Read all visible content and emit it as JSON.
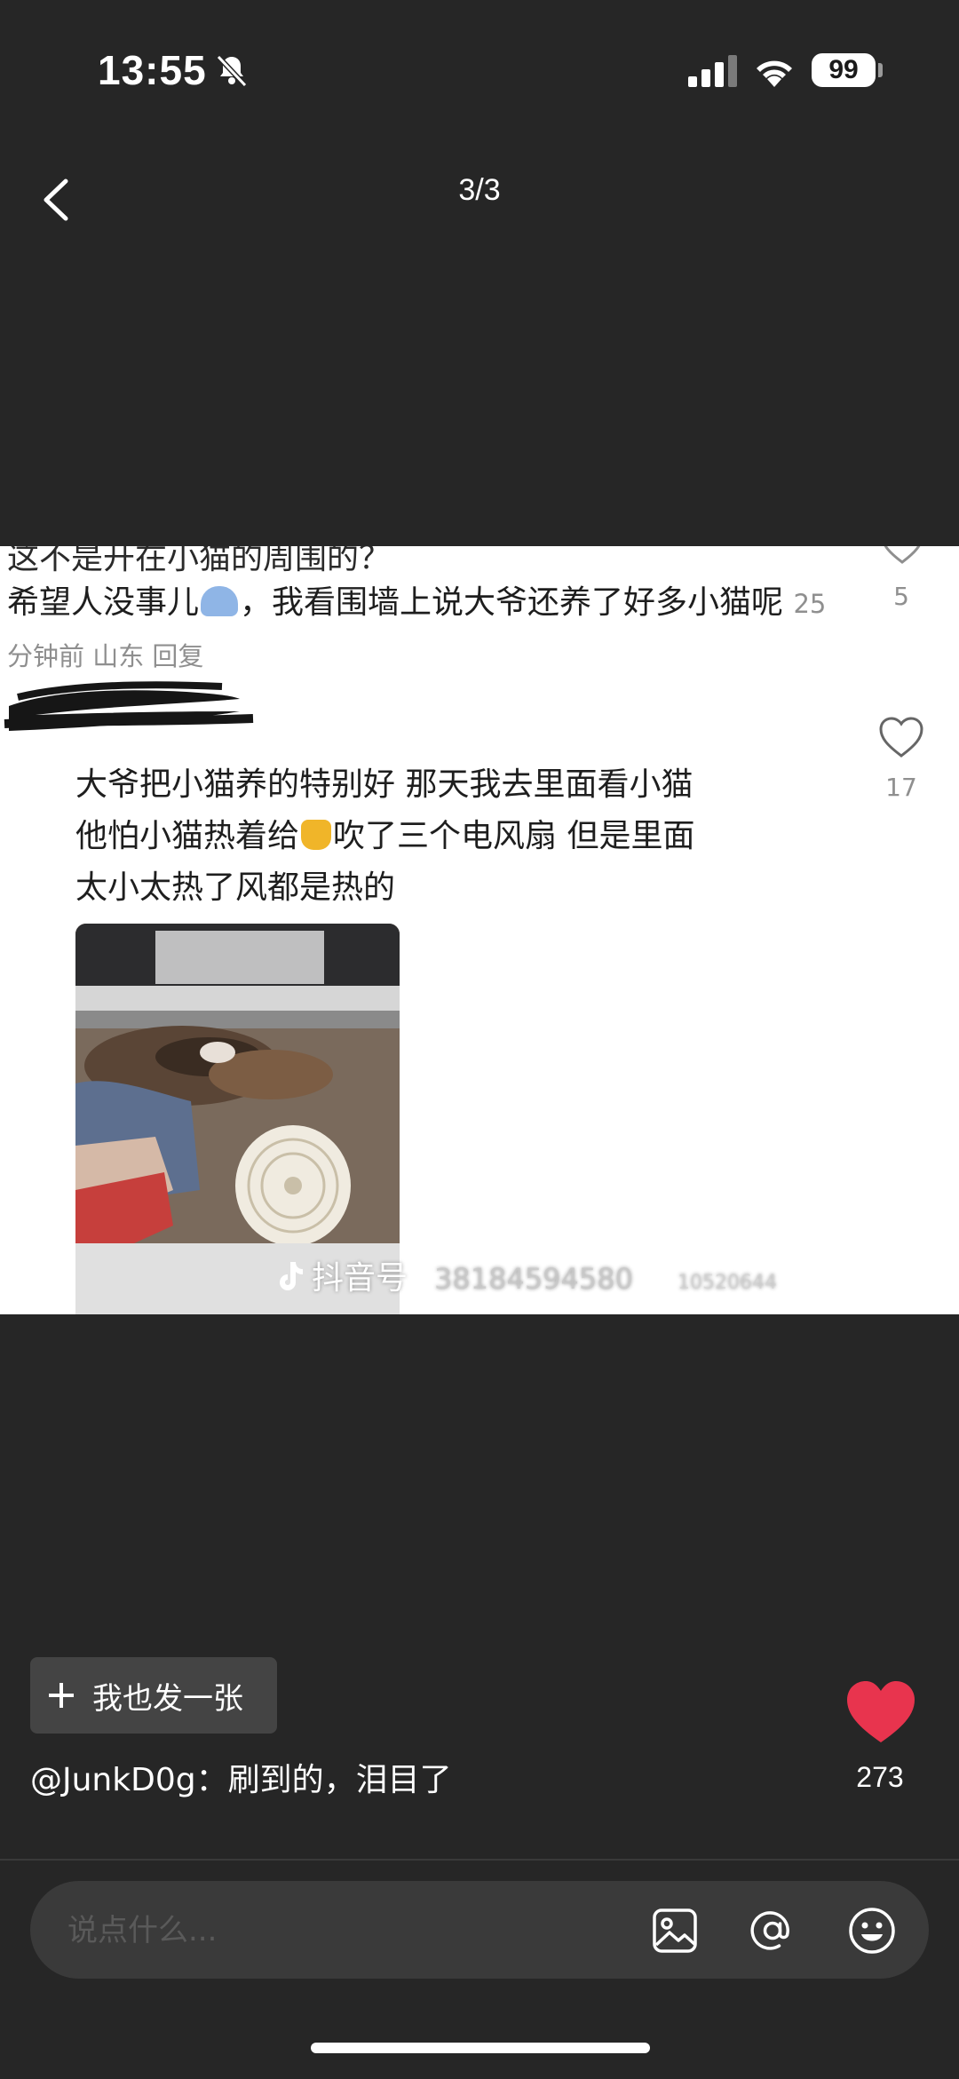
{
  "status_bar": {
    "time": "13:55",
    "battery": "99",
    "icons": [
      "bell-off-icon",
      "signal-icon",
      "wifi-icon",
      "battery-icon"
    ]
  },
  "header": {
    "page_counter": "3/3",
    "back_icon": "chevron-left-icon"
  },
  "screenshot": {
    "cut_top_line": "这不是开在小猫的周围的？",
    "comment1": {
      "text": "希望人没事儿",
      "text_after_emoji": "，我看围墙上说大爷还养了好多小猫呢",
      "meta": "25分钟前 山东 回复",
      "likes": "5"
    },
    "comment2": {
      "line1": "大爷把小猫养的特别好 那天我去里面看小猫",
      "line2_before": "他怕小猫热着给",
      "line2_after": "吹了三个电风扇 但是里面",
      "line3": "太小太热了风都是热的",
      "likes": "17"
    },
    "watermark": {
      "label": "抖音号",
      "id": "38184594580",
      "extra": "10520644"
    }
  },
  "bottom": {
    "post_button_label": "我也发一张",
    "caption": "@JunkD0g：刷到的，泪目了",
    "like_count": "273",
    "comment_placeholder": "说点什么...",
    "colors": {
      "like_heart": "#e8344e",
      "background": "#262626"
    }
  }
}
